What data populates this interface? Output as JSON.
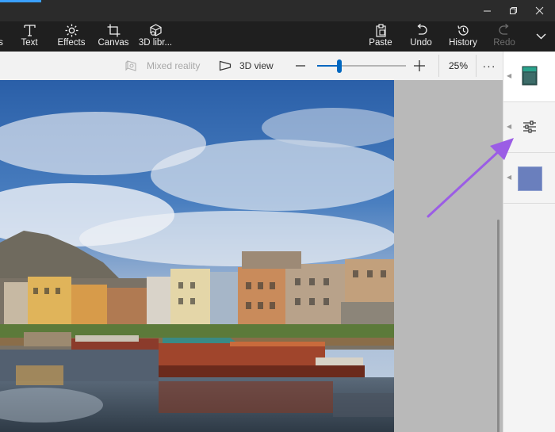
{
  "ribbon": {
    "text_label": "Text",
    "effects_label": "Effects",
    "canvas_label": "Canvas",
    "library_label": "3D libr...",
    "paste_label": "Paste",
    "undo_label": "Undo",
    "history_label": "History",
    "redo_label": "Redo"
  },
  "toolbar": {
    "mixed_reality_label": "Mixed reality",
    "view_3d_label": "3D view",
    "zoom_value": 25,
    "zoom_label": "25%",
    "more_label": "···"
  },
  "panel": {
    "swatch_color": "#6a7fbd"
  },
  "colors": {
    "accent": "#0067c0",
    "annotation_arrow": "#9b5de5"
  }
}
